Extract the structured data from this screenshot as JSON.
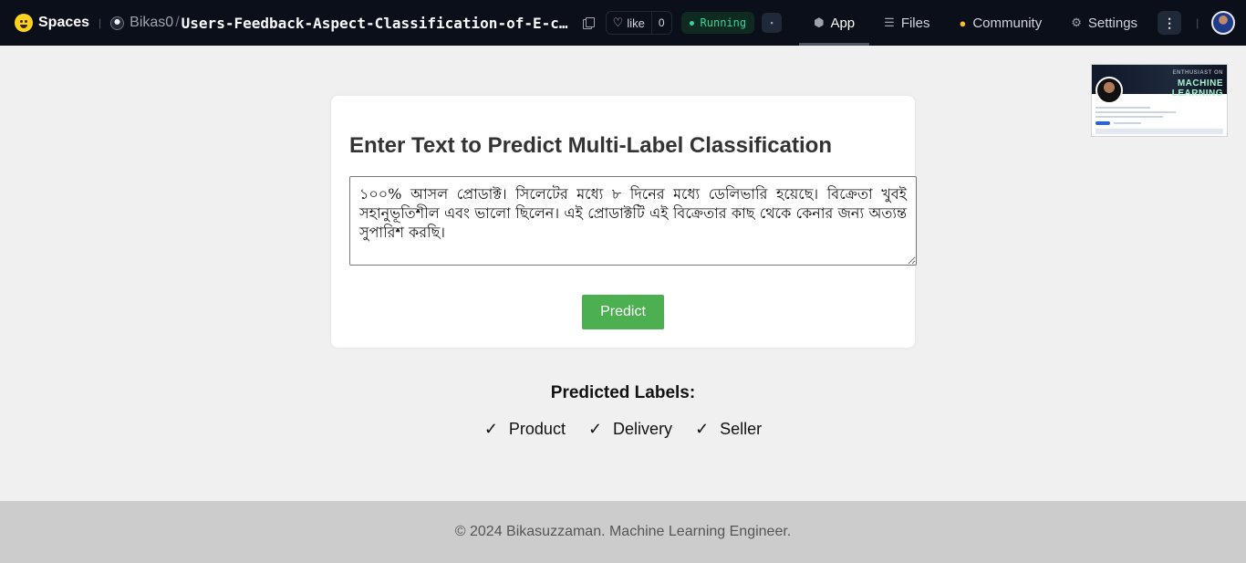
{
  "topbar": {
    "brand": "Spaces",
    "owner": "Bikas0",
    "separator": "/",
    "repo_name": "Users-Feedback-Aspect-Classification-of-E-commerce",
    "like_label": "like",
    "like_count": "0",
    "status": "Running",
    "tabs": [
      {
        "label": "App",
        "icon": "cube-icon",
        "active": true
      },
      {
        "label": "Files",
        "icon": "files-icon",
        "active": false
      },
      {
        "label": "Community",
        "icon": "community-icon",
        "active": false
      },
      {
        "label": "Settings",
        "icon": "gear-icon",
        "active": false
      }
    ]
  },
  "main": {
    "title": "Enter Text to Predict Multi-Label Classification",
    "input_text": "১০০% আসল প্রোডাক্ট। সিলেটের মধ্যে ৮ দিনের মধ্যে ডেলিভারি হয়েছে। বিক্রেতা খুবই সহানুভূতিশীল এবং ভালো ছিলেন। এই প্রোডাক্টটি এই বিক্রেতার কাছ থেকে কেনার জন্য অত্যন্ত সুপারিশ করছি।",
    "predict_label": "Predict",
    "results_title": "Predicted Labels:",
    "check_glyph": "✓",
    "predicted_labels": [
      "Product",
      "Delivery",
      "Seller"
    ]
  },
  "thumbnail": {
    "banner_line1": "ENTHUSIAST ON",
    "banner_line2": "MACHINE",
    "banner_line3": "LEARNING"
  },
  "footer": {
    "text": "© 2024 Bikasuzzaman. Machine Learning Engineer."
  },
  "colors": {
    "topbar_bg": "#0b0f19",
    "page_bg": "#f0f0f0",
    "predict_button": "#4caf50",
    "status_green": "#34d399",
    "footer_bg": "#cccccc"
  }
}
